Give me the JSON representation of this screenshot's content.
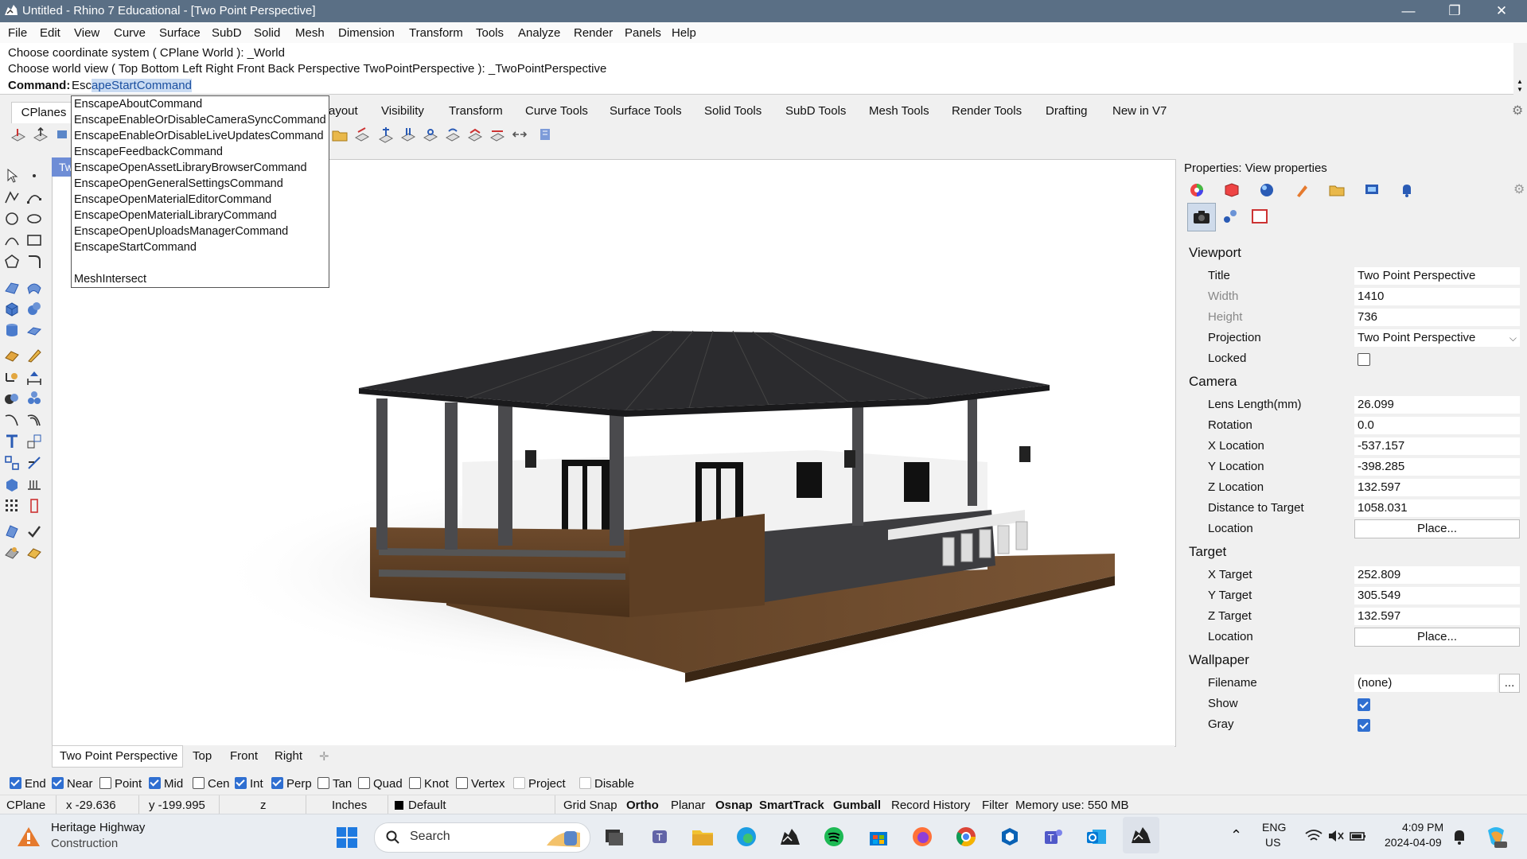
{
  "window": {
    "title": "Untitled - Rhino 7 Educational - [Two Point Perspective]"
  },
  "menu": [
    "File",
    "Edit",
    "View",
    "Curve",
    "Surface",
    "SubD",
    "Solid",
    "Mesh",
    "Dimension",
    "Transform",
    "Tools",
    "Analyze",
    "Render",
    "Panels",
    "Help"
  ],
  "command_history": [
    "Choose coordinate system ( CPlane  World ): _World",
    "Choose world view ( Top  Bottom  Left  Right  Front  Back  Perspective  TwoPointPerspective ): _TwoPointPerspective"
  ],
  "command": {
    "label": "Command:",
    "typed": "Esc",
    "selected": "apeStartCommand"
  },
  "autocomplete": [
    "EnscapeAboutCommand",
    "EnscapeEnableOrDisableCameraSyncCommand",
    "EnscapeEnableOrDisableLiveUpdatesCommand",
    "EnscapeFeedbackCommand",
    "EnscapeOpenAssetLibraryBrowserCommand",
    "EnscapeOpenGeneralSettingsCommand",
    "EnscapeOpenMaterialEditorCommand",
    "EnscapeOpenMaterialLibraryCommand",
    "EnscapeOpenUploadsManagerCommand",
    "EnscapeStartCommand",
    "MeshIntersect"
  ],
  "toolbar_tabs": [
    "CPlanes",
    "ayout",
    "Visibility",
    "Transform",
    "Curve Tools",
    "Surface Tools",
    "Solid Tools",
    "SubD Tools",
    "Mesh Tools",
    "Render Tools",
    "Drafting",
    "New in V7"
  ],
  "viewport": {
    "corner_label": "Tw"
  },
  "viewport_tabs": [
    "Two Point Perspective",
    "Top",
    "Front",
    "Right"
  ],
  "osnaps": [
    {
      "label": "End",
      "checked": true
    },
    {
      "label": "Near",
      "checked": true
    },
    {
      "label": "Point",
      "checked": false
    },
    {
      "label": "Mid",
      "checked": true
    },
    {
      "label": "Cen",
      "checked": false
    },
    {
      "label": "Int",
      "checked": true
    },
    {
      "label": "Perp",
      "checked": true
    },
    {
      "label": "Tan",
      "checked": false
    },
    {
      "label": "Quad",
      "checked": false
    },
    {
      "label": "Knot",
      "checked": false
    },
    {
      "label": "Vertex",
      "checked": false
    },
    {
      "label": "Project",
      "checked": false
    },
    {
      "label": "Disable",
      "checked": false
    }
  ],
  "status": {
    "cplane": "CPlane",
    "x": "x -29.636",
    "y": "y -199.995",
    "z": "z",
    "units": "Inches",
    "layer": "Default",
    "grid_snap": "Grid Snap",
    "ortho": "Ortho",
    "planar": "Planar",
    "osnap": "Osnap",
    "smarttrack": "SmartTrack",
    "gumball": "Gumball",
    "record_history": "Record History",
    "filter": "Filter",
    "memory": "Memory use: 550 MB"
  },
  "properties": {
    "header": "Properties: View properties",
    "viewport_section": "Viewport",
    "title_label": "Title",
    "title": "Two Point Perspective",
    "width_label": "Width",
    "width": "1410",
    "height_label": "Height",
    "height": "736",
    "projection_label": "Projection",
    "projection": "Two Point Perspective",
    "locked_label": "Locked",
    "camera_section": "Camera",
    "lens_label": "Lens Length(mm)",
    "lens": "26.099",
    "rotation_label": "Rotation",
    "rotation": "0.0",
    "xloc_label": "X Location",
    "xloc": "-537.157",
    "yloc_label": "Y Location",
    "yloc": "-398.285",
    "zloc_label": "Z Location",
    "zloc": "132.597",
    "dist_label": "Distance to Target",
    "dist": "1058.031",
    "cam_location_label": "Location",
    "place": "Place...",
    "target_section": "Target",
    "xt_label": "X Target",
    "xt": "252.809",
    "yt_label": "Y Target",
    "yt": "305.549",
    "zt_label": "Z Target",
    "zt": "132.597",
    "tgt_location_label": "Location",
    "wallpaper_section": "Wallpaper",
    "filename_label": "Filename",
    "filename": "(none)",
    "browse": "...",
    "show_label": "Show",
    "gray_label": "Gray"
  },
  "taskbar": {
    "weather_title": "Heritage Highway",
    "weather_sub": "Construction",
    "search": "Search",
    "lang1": "ENG",
    "lang2": "US",
    "time": "4:09 PM",
    "date": "2024-04-09"
  }
}
